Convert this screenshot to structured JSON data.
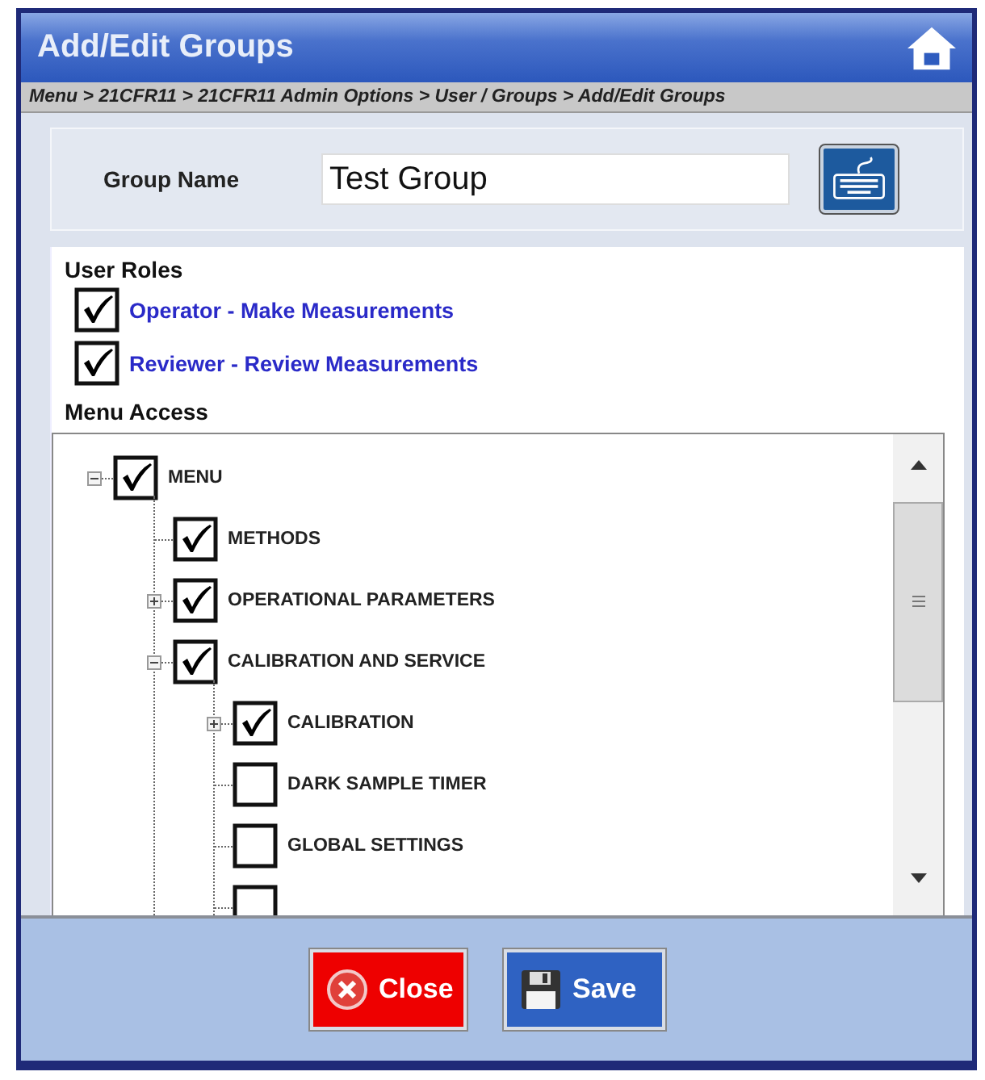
{
  "window": {
    "title": "Add/Edit Groups"
  },
  "breadcrumb": "Menu > 21CFR11 > 21CFR11 Admin Options > User / Groups > Add/Edit Groups",
  "group_name": {
    "label": "Group Name",
    "value": "Test Group"
  },
  "user_roles": {
    "heading": "User Roles",
    "items": [
      {
        "label": "Operator - Make Measurements",
        "checked": true
      },
      {
        "label": "Reviewer - Review Measurements",
        "checked": true
      }
    ]
  },
  "menu_access": {
    "heading": "Menu Access",
    "tree": [
      {
        "label": "MENU",
        "checked": true,
        "expanded": true,
        "children": [
          {
            "label": "METHODS",
            "checked": true
          },
          {
            "label": "OPERATIONAL PARAMETERS",
            "checked": true,
            "expanded": false
          },
          {
            "label": "CALIBRATION AND SERVICE",
            "checked": true,
            "expanded": true,
            "children": [
              {
                "label": "CALIBRATION",
                "checked": true,
                "expanded": false
              },
              {
                "label": "DARK SAMPLE TIMER",
                "checked": false
              },
              {
                "label": "GLOBAL SETTINGS",
                "checked": false
              },
              {
                "checked": false
              }
            ]
          }
        ]
      }
    ]
  },
  "buttons": [
    {
      "label": "Close",
      "kind": "close"
    },
    {
      "label": "Save",
      "kind": "save"
    }
  ]
}
